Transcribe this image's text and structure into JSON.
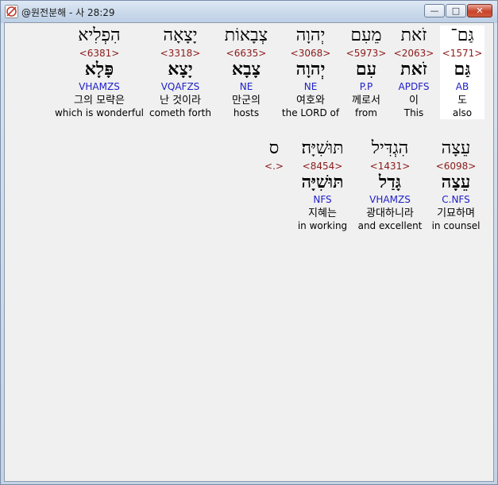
{
  "window": {
    "title": "@원전분해 - 사 28:29",
    "buttons": {
      "minimize": "—",
      "maximize": "□",
      "close": "✕"
    }
  },
  "words": [
    {
      "surface": "גַּם־",
      "strong": "<1571>",
      "root": "גַּם",
      "morph": "AB",
      "korean": "도",
      "english": "also",
      "highlight": true
    },
    {
      "surface": "זֹאת",
      "strong": "<2063>",
      "root": "זֹאת",
      "morph": "APDFS",
      "korean": "이",
      "english": "This",
      "highlight": false
    },
    {
      "surface": "מֵעִם",
      "strong": "<5973>",
      "root": "עִם",
      "morph": "P.P",
      "korean": "께로서",
      "english": "from",
      "highlight": false
    },
    {
      "surface": "יְהוָה",
      "strong": "<3068>",
      "root": "יְהוָה",
      "morph": "NE",
      "korean": "여호와",
      "english": "the LORD of",
      "highlight": false
    },
    {
      "surface": "צְבָאוֹת",
      "strong": "<6635>",
      "root": "צָבָא",
      "morph": "NE",
      "korean": "만군의",
      "english": "hosts",
      "highlight": false
    },
    {
      "surface": "יָצָאָה",
      "strong": "<3318>",
      "root": "יָצָא",
      "morph": "VQAFZS",
      "korean": "난 것이라",
      "english": "cometh forth",
      "highlight": false
    },
    {
      "surface": "הִפְלִיא",
      "strong": "<6381>",
      "root": "פָּלָא",
      "morph": "VHAMZS",
      "korean": "그의 모략은",
      "english": "which is wonderful",
      "highlight": false
    },
    {
      "surface": "עֵצָה",
      "strong": "<6098>",
      "root": "עֵצָה",
      "morph": "C.NFS",
      "korean": "기묘하며",
      "english": "in counsel",
      "highlight": false
    },
    {
      "surface": "הִגְדִּיל",
      "strong": "<1431>",
      "root": "גָּדַל",
      "morph": "VHAMZS",
      "korean": "광대하니라",
      "english": "and excellent",
      "highlight": false
    },
    {
      "surface": "תּוּשִׁיָּה׃",
      "strong": "<8454>",
      "root": "תּוּשִׁיָּה",
      "morph": "NFS",
      "korean": "지혜는",
      "english": "in working",
      "highlight": false
    },
    {
      "surface": "ס",
      "strong": "<.>",
      "root": "",
      "morph": "",
      "korean": "",
      "english": "",
      "highlight": false
    }
  ]
}
